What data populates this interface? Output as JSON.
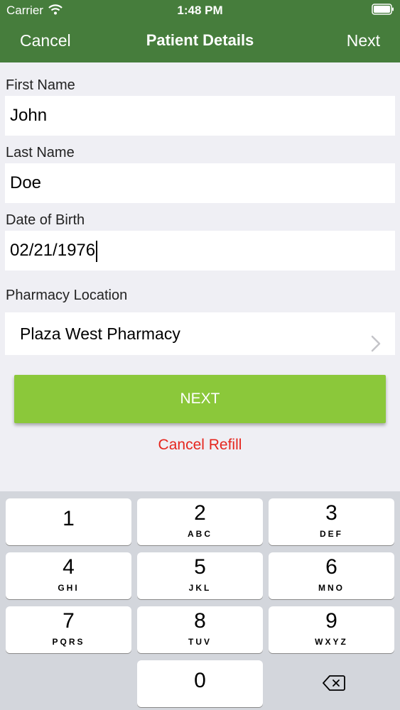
{
  "status_bar": {
    "carrier": "Carrier",
    "time": "1:48 PM"
  },
  "nav": {
    "cancel_label": "Cancel",
    "title": "Patient Details",
    "next_label": "Next"
  },
  "form": {
    "first_name": {
      "label": "First Name",
      "value": "John"
    },
    "last_name": {
      "label": "Last Name",
      "value": "Doe"
    },
    "dob": {
      "label": "Date of Birth",
      "value": "02/21/1976"
    },
    "pharmacy": {
      "label": "Pharmacy Location",
      "value": "Plaza West Pharmacy"
    }
  },
  "actions": {
    "next_label": "NEXT",
    "cancel_refill_label": "Cancel Refill"
  },
  "keyboard": {
    "keys": [
      {
        "digit": "1",
        "letters": ""
      },
      {
        "digit": "2",
        "letters": "ABC"
      },
      {
        "digit": "3",
        "letters": "DEF"
      },
      {
        "digit": "4",
        "letters": "GHI"
      },
      {
        "digit": "5",
        "letters": "JKL"
      },
      {
        "digit": "6",
        "letters": "MNO"
      },
      {
        "digit": "7",
        "letters": "PQRS"
      },
      {
        "digit": "8",
        "letters": "TUV"
      },
      {
        "digit": "9",
        "letters": "WXYZ"
      },
      {
        "digit": "0",
        "letters": ""
      }
    ]
  },
  "colors": {
    "nav_bar": "#467d3c",
    "next_button": "#8bc83a",
    "cancel_refill": "#e5261e",
    "background": "#efeff4",
    "keyboard": "#d3d6dc"
  },
  "icons": [
    "wifi-icon",
    "battery-icon",
    "chevron-right-icon",
    "backspace-icon"
  ]
}
